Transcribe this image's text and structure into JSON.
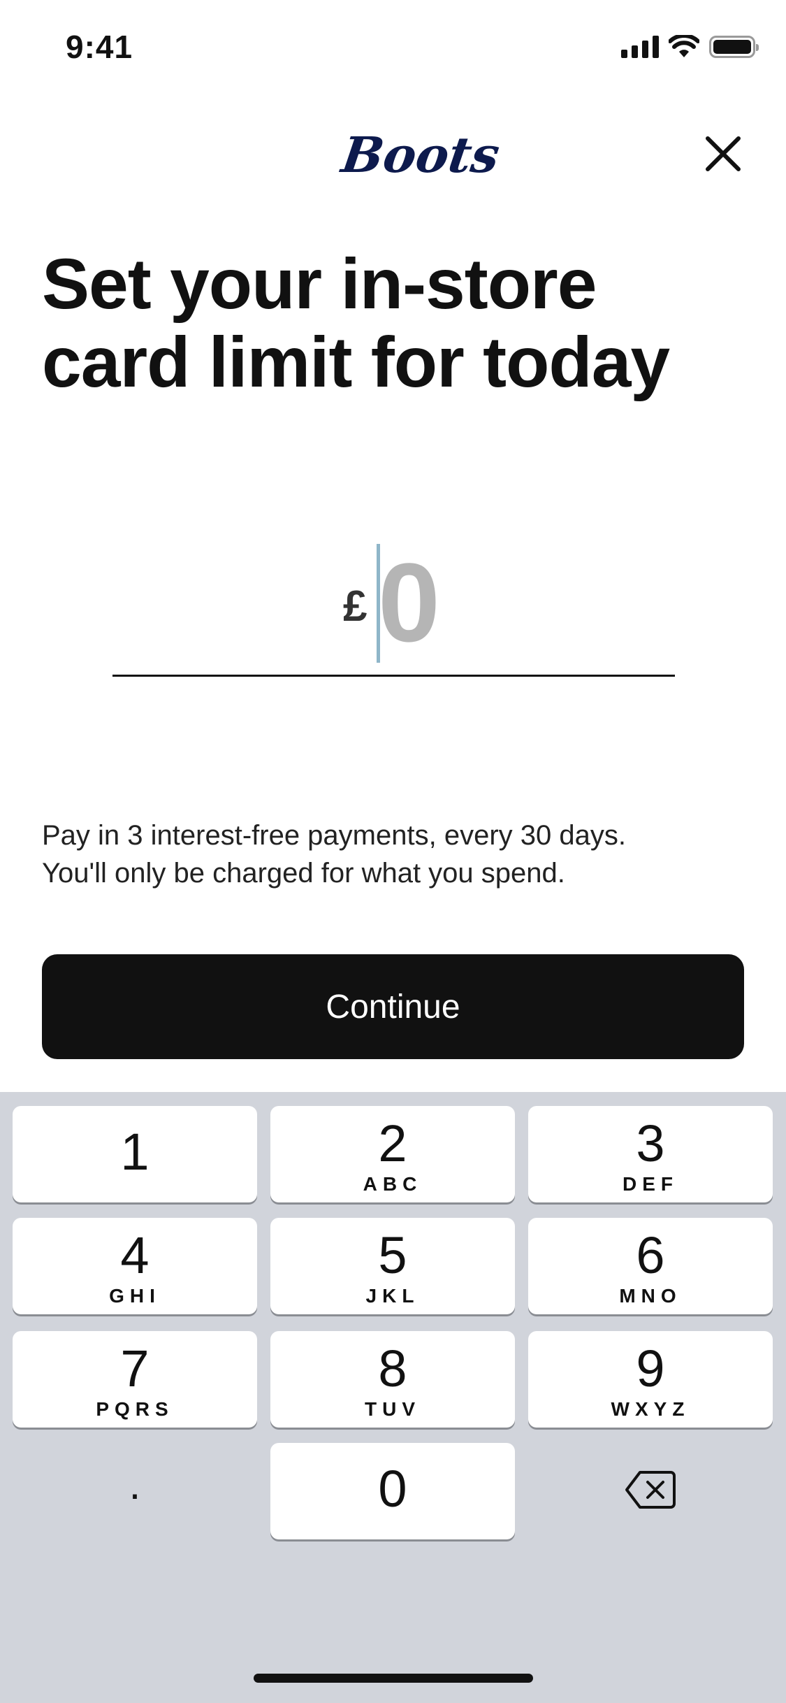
{
  "status_bar": {
    "time": "9:41"
  },
  "header": {
    "logo_text": "Boots",
    "close_icon": "close-icon"
  },
  "title": "Set your in-store card limit for today",
  "amount": {
    "currency": "£",
    "value": "0"
  },
  "info": {
    "line1": "Pay in 3 interest-free payments, every 30 days.",
    "line2": "You'll only be charged for what you spend."
  },
  "continue_label": "Continue",
  "keyboard": {
    "keys": [
      {
        "num": "1",
        "letters": ""
      },
      {
        "num": "2",
        "letters": "ABC"
      },
      {
        "num": "3",
        "letters": "DEF"
      },
      {
        "num": "4",
        "letters": "GHI"
      },
      {
        "num": "5",
        "letters": "JKL"
      },
      {
        "num": "6",
        "letters": "MNO"
      },
      {
        "num": "7",
        "letters": "PQRS"
      },
      {
        "num": "8",
        "letters": "TUV"
      },
      {
        "num": "9",
        "letters": "WXYZ"
      },
      {
        "num": "0",
        "letters": ""
      }
    ],
    "decimal": ".",
    "backspace_icon": "backspace-icon"
  }
}
